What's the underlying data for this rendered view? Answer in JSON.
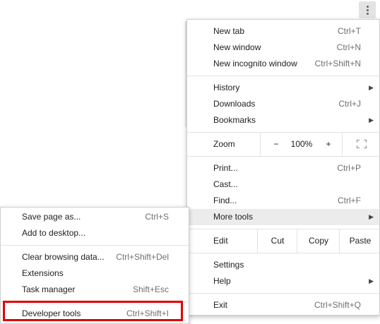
{
  "main_menu": {
    "group1": [
      {
        "label": "New tab",
        "accel": "Ctrl+T"
      },
      {
        "label": "New window",
        "accel": "Ctrl+N"
      },
      {
        "label": "New incognito window",
        "accel": "Ctrl+Shift+N"
      }
    ],
    "history": {
      "label": "History"
    },
    "downloads": {
      "label": "Downloads",
      "accel": "Ctrl+J"
    },
    "bookmarks": {
      "label": "Bookmarks"
    },
    "zoom": {
      "label": "Zoom",
      "minus": "−",
      "value": "100%",
      "plus": "+"
    },
    "print": {
      "label": "Print...",
      "accel": "Ctrl+P"
    },
    "cast": {
      "label": "Cast..."
    },
    "find": {
      "label": "Find...",
      "accel": "Ctrl+F"
    },
    "more_tools": {
      "label": "More tools"
    },
    "edit": {
      "label": "Edit",
      "cut": "Cut",
      "copy": "Copy",
      "paste": "Paste"
    },
    "settings": {
      "label": "Settings"
    },
    "help": {
      "label": "Help"
    },
    "exit": {
      "label": "Exit",
      "accel": "Ctrl+Shift+Q"
    }
  },
  "sub_menu": {
    "save_page": {
      "label": "Save page as...",
      "accel": "Ctrl+S"
    },
    "add_desktop": {
      "label": "Add to desktop..."
    },
    "clear_data": {
      "label": "Clear browsing data...",
      "accel": "Ctrl+Shift+Del"
    },
    "extensions": {
      "label": "Extensions"
    },
    "task_manager": {
      "label": "Task manager",
      "accel": "Shift+Esc"
    },
    "dev_tools": {
      "label": "Developer tools",
      "accel": "Ctrl+Shift+I"
    }
  },
  "colors": {
    "highlight": "#e20000",
    "hover": "#ececec"
  }
}
